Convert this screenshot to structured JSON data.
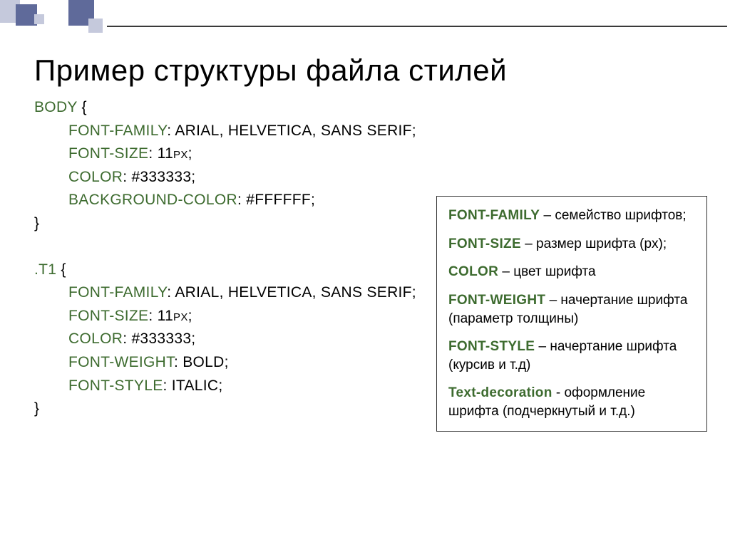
{
  "title": "Пример структуры файла стилей",
  "code": {
    "block1": {
      "selector": "Body",
      "brace_open": "{",
      "brace_close": "}",
      "lines": [
        {
          "prop": "font-family",
          "val": ": Arial, Helvetica, sans serif;"
        },
        {
          "prop": "font-size",
          "val": ": 11px;"
        },
        {
          "prop": "color",
          "val": ":   #333333;"
        },
        {
          "prop": "background-color",
          "val": ":    #FFFFFF;"
        }
      ]
    },
    "block2": {
      "selector": ".T1",
      "brace_open": "{",
      "brace_close": "}",
      "lines": [
        {
          "prop": "font-family",
          "val": ": Arial, Helvetica, sans serif;"
        },
        {
          "prop": "font-size",
          "val": ": 11px;"
        },
        {
          "prop": "color",
          "val": ":   #333333;"
        },
        {
          "prop": "font-weight",
          "val": ":   Bold;"
        },
        {
          "prop": "font-style",
          "val": ":   Italic;"
        }
      ]
    }
  },
  "legend": [
    {
      "key": "Font-family",
      "desc": " – семейство шрифтов;"
    },
    {
      "key": "Font-size",
      "desc": " – размер шрифта (px);"
    },
    {
      "key": "Color",
      "desc": " – цвет шрифта"
    },
    {
      "key": "Font-weight",
      "desc": " – начертание шрифта (параметр толщины)"
    },
    {
      "key": "Font-style",
      "desc": " – начертание шрифта (курсив и т.д)"
    },
    {
      "key": "Text-decoration",
      "desc": "  - оформление шрифта (подчеркнутый и т.д.)"
    }
  ]
}
